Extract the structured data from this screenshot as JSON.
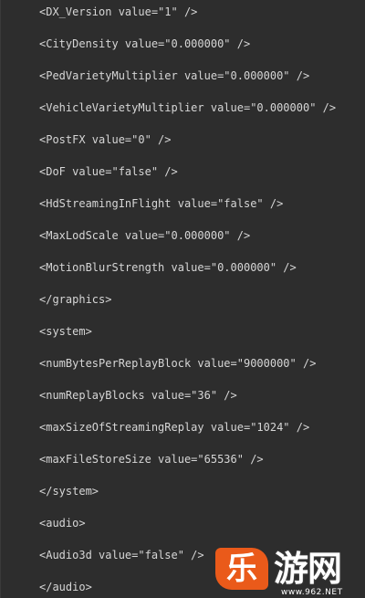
{
  "editor": {
    "lines": [
      "<DX_Version value=\"1\" />",
      "<CityDensity value=\"0.000000\" />",
      "<PedVarietyMultiplier value=\"0.000000\" />",
      "<VehicleVarietyMultiplier value=\"0.000000\" />",
      "<PostFX value=\"0\" />",
      "<DoF value=\"false\" />",
      "<HdStreamingInFlight value=\"false\" />",
      "<MaxLodScale value=\"0.000000\" />",
      "<MotionBlurStrength value=\"0.000000\" />",
      "</graphics>",
      "<system>",
      "<numBytesPerReplayBlock value=\"9000000\" />",
      "<numReplayBlocks value=\"36\" />",
      "<maxSizeOfStreamingReplay value=\"1024\" />",
      "<maxFileStoreSize value=\"65536\" />",
      "</system>",
      "<audio>",
      "<Audio3d value=\"false\" />",
      "</audio>"
    ]
  },
  "watermark": {
    "badge_char": "乐",
    "text": "游网",
    "url": "www.962.NET"
  },
  "colors": {
    "background": "#2d2d2d",
    "text": "#d6d6d6",
    "badge": "#ea5a1a"
  }
}
